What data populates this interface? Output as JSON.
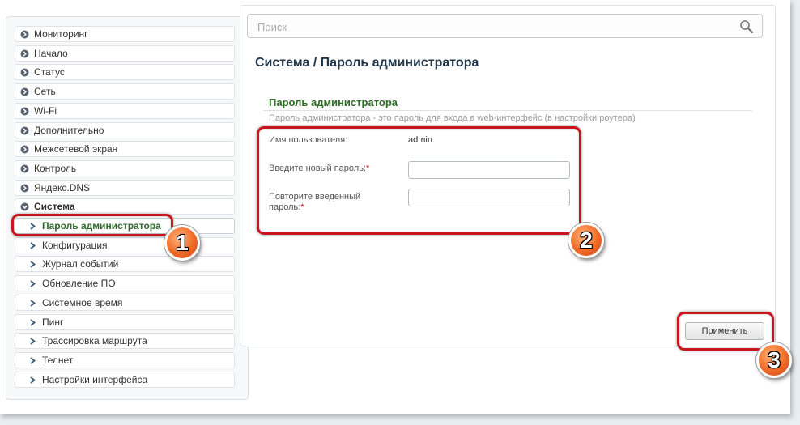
{
  "sidebar": {
    "items": [
      {
        "label": "Мониторинг",
        "type": "top",
        "icon": "chevron-circle-right-icon"
      },
      {
        "label": "Начало",
        "type": "top",
        "icon": "chevron-circle-right-icon"
      },
      {
        "label": "Статус",
        "type": "top",
        "icon": "chevron-circle-right-icon"
      },
      {
        "label": "Сеть",
        "type": "top",
        "icon": "chevron-circle-right-icon"
      },
      {
        "label": "Wi-Fi",
        "type": "top",
        "icon": "chevron-circle-right-icon"
      },
      {
        "label": "Дополнительно",
        "type": "top",
        "icon": "chevron-circle-right-icon"
      },
      {
        "label": "Межсетевой экран",
        "type": "top",
        "icon": "chevron-circle-right-icon"
      },
      {
        "label": "Контроль",
        "type": "top",
        "icon": "chevron-circle-right-icon"
      },
      {
        "label": "Яндекс.DNS",
        "type": "top",
        "icon": "chevron-circle-right-icon"
      },
      {
        "label": "Система",
        "type": "parent",
        "icon": "chevron-circle-down-icon"
      },
      {
        "label": "Пароль администратора",
        "type": "sub-active",
        "icon": "arrow-right-icon"
      },
      {
        "label": "Конфигурация",
        "type": "sub",
        "icon": "arrow-right-icon"
      },
      {
        "label": "Журнал событий",
        "type": "sub",
        "icon": "arrow-right-icon"
      },
      {
        "label": "Обновление ПО",
        "type": "sub",
        "icon": "arrow-right-icon"
      },
      {
        "label": "Системное время",
        "type": "sub",
        "icon": "arrow-right-icon"
      },
      {
        "label": "Пинг",
        "type": "sub",
        "icon": "arrow-right-icon"
      },
      {
        "label": "Трассировка маршрута",
        "type": "sub",
        "icon": "arrow-right-icon"
      },
      {
        "label": "Телнет",
        "type": "sub",
        "icon": "arrow-right-icon"
      },
      {
        "label": "Настройки интерфейса",
        "type": "sub",
        "icon": "arrow-right-icon"
      }
    ]
  },
  "search": {
    "placeholder": "Поиск",
    "icon": "search-icon"
  },
  "page": {
    "breadcrumb": "Система /  Пароль администратора",
    "section_title": "Пароль администратора",
    "section_desc": "Пароль администратора - это пароль для входа в web-интерфейс (в настройки роутера)"
  },
  "form": {
    "username_label": "Имя пользователя:",
    "username_value": "admin",
    "new_password_label": "Введите новый пароль:",
    "repeat_password_label_line1": "Повторите введенный",
    "repeat_password_label_line2": "пароль:",
    "required_mark": "*",
    "new_password_value": "",
    "repeat_password_value": ""
  },
  "apply_button": {
    "label": "Применить"
  },
  "annotations": {
    "step1": "1",
    "step2": "2",
    "step3": "3"
  },
  "colors": {
    "highlight": "#c8161e",
    "badge": "#f06a26",
    "active_menu": "#2e6b2a",
    "section_title": "#2c6c23",
    "page_title": "#23374a"
  }
}
